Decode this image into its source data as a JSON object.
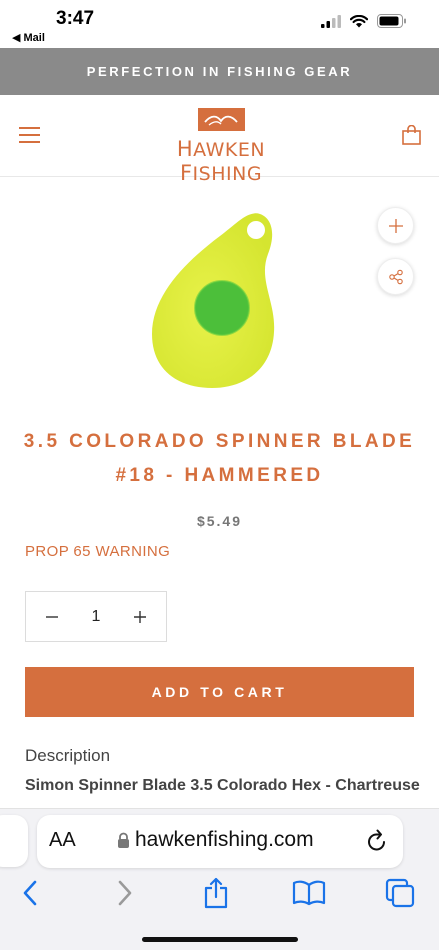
{
  "status_bar": {
    "time": "3:47",
    "back_label": "◀ Mail"
  },
  "announcement": {
    "text": "PERFECTION IN FISHING GEAR"
  },
  "header": {
    "logo_text_first": "H",
    "logo_text_rest": "AWKEN ",
    "logo_text_second": "F",
    "logo_text_end": "ISHING"
  },
  "product": {
    "title": "3.5 COLORADO SPINNER BLADE #18 - HAMMERED",
    "price": "$5.49",
    "prop65": "PROP 65 WARNING",
    "quantity": "1",
    "add_to_cart": "ADD TO CART",
    "description_label": "Description",
    "description_text": "Simon Spinner Blade 3.5 Colorado Hex - Chartreuse"
  },
  "browser": {
    "text_size_label": "AA",
    "url": "hawkenfishing.com"
  },
  "colors": {
    "brand": "#d56f3e",
    "announce_bg": "#8a8a8a",
    "ios_blue": "#1a73e8"
  },
  "icons": [
    "hamburger-icon",
    "bag-icon",
    "plus-icon",
    "share-icon",
    "minus-icon",
    "lock-icon",
    "reload-icon",
    "back-icon",
    "forward-icon",
    "share-sheet-icon",
    "bookmarks-icon",
    "tabs-icon"
  ]
}
